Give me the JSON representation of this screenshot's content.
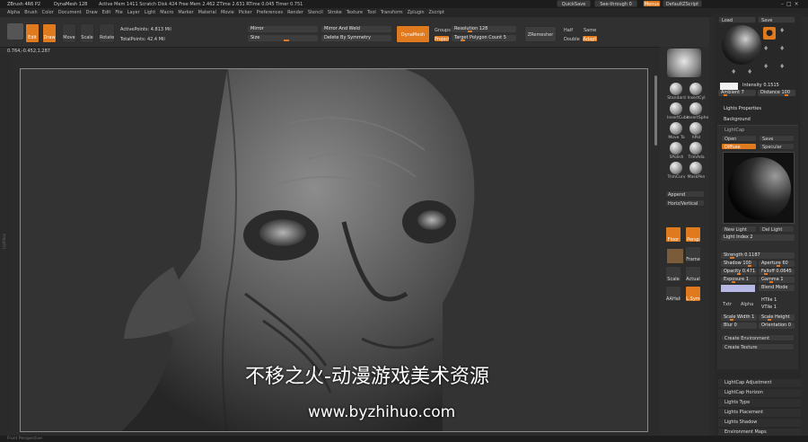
{
  "app": {
    "title": "ZBrush 4R6 P2",
    "preview": "DynaMesh 128",
    "stats": "Active Mem 1411  Scratch Disk 424  Free Mem 2.462  ZTime 2.631  RTime 0.045  Timer 0.751"
  },
  "menubar": {
    "items": [
      "Alpha",
      "Brush",
      "Color",
      "Document",
      "Draw",
      "Edit",
      "File",
      "Layer",
      "Light",
      "Macro",
      "Marker",
      "Material",
      "Movie",
      "Picker",
      "Preferences",
      "Render",
      "Stencil",
      "Stroke",
      "Texture",
      "Tool",
      "Transform",
      "Zplugin",
      "Zscript"
    ]
  },
  "topright": {
    "quicksave": "QuickSave",
    "seethrough": "See-through   0",
    "menus": "Menus",
    "script": "DefaultZScript"
  },
  "toolbar": {
    "edit": "Edit",
    "draw": "Draw",
    "move": "Move",
    "scale": "Scale",
    "rotate": "Rotate",
    "active_points": "ActivePoints: 4.813 Mil",
    "total_points": "TotalPoints: 42.4 Mil",
    "mirror": "Mirror",
    "mirror_weld": "Mirror And Weld",
    "size": "Size",
    "delete_symmetry": "Delete By Symmetry",
    "dynamesh": "DynaMesh",
    "groups": "Groups",
    "resolution": "Resolution 128",
    "project": "Project",
    "target_polygon": "Target Polygon Count 5",
    "zremesher": "ZRemesher",
    "half": "Half",
    "same": "Same",
    "double": "Double",
    "adapt": "Adapt"
  },
  "coords": "0.764,-0.452,1.287",
  "left_shelf": "Lightbox",
  "right_shelf": {
    "brushes": [
      "Standard",
      "InsertCyl",
      "InsertCube",
      "InsertSphe",
      "Move Ta",
      "hPol",
      "SPolish",
      "TrimAda",
      "TrimCurv",
      "MaskPen"
    ],
    "append": "Append",
    "vertical": "Horiz/Vertical",
    "shelf_btns": [
      "Floor",
      "Persp",
      "Local",
      "Frame",
      "Scale",
      "Actual",
      "AAHalf",
      "L.Sym"
    ]
  },
  "light": {
    "load": "Load",
    "save": "Save",
    "intensity": "Intensity 0.1515",
    "ambient": "Ambient 7",
    "distance": "Distance 100",
    "properties": "Lights Properties",
    "background": "Background",
    "lightcap": "LightCap",
    "open": "Open",
    "save2": "Save",
    "diffuse": "Diffuse",
    "specular": "Specular",
    "new_light": "New Light",
    "del_light": "Del Light",
    "light_index": "Light Index 2",
    "strength": "Strength 0.1187",
    "shadow": "Shadow 100",
    "aperture": "Aperture 60",
    "opacity": "Opacity 0.471",
    "falloff": "Falloff 0.0645",
    "exposure": "Exposure 1",
    "gamma": "Gamma 1",
    "blend": "Blend Mode",
    "txtr": "Txtr",
    "alpha": "Alpha",
    "h_tile": "HTile 1",
    "v_tile": "VTile 1",
    "scale_w": "Scale Width 1",
    "scale_h": "Scale Height",
    "blur": "Blur 0",
    "orientation": "Orientation 0",
    "create_env": "Create Environment",
    "create_tex": "Create Texture"
  },
  "bottom_menu": [
    "LightCap Adjustment",
    "LightCap Horizon",
    "Lights Type",
    "Lights Placement",
    "Lights Shadow",
    "Environment Maps"
  ],
  "status": "Front Perspective",
  "watermark": {
    "line1": "不移之火-动漫游戏美术资源",
    "line2": "www.byzhihuo.com"
  },
  "colors": {
    "accent": "#e07a1f",
    "panel": "#2f2f2f",
    "canvas": "#2a2a2a"
  }
}
